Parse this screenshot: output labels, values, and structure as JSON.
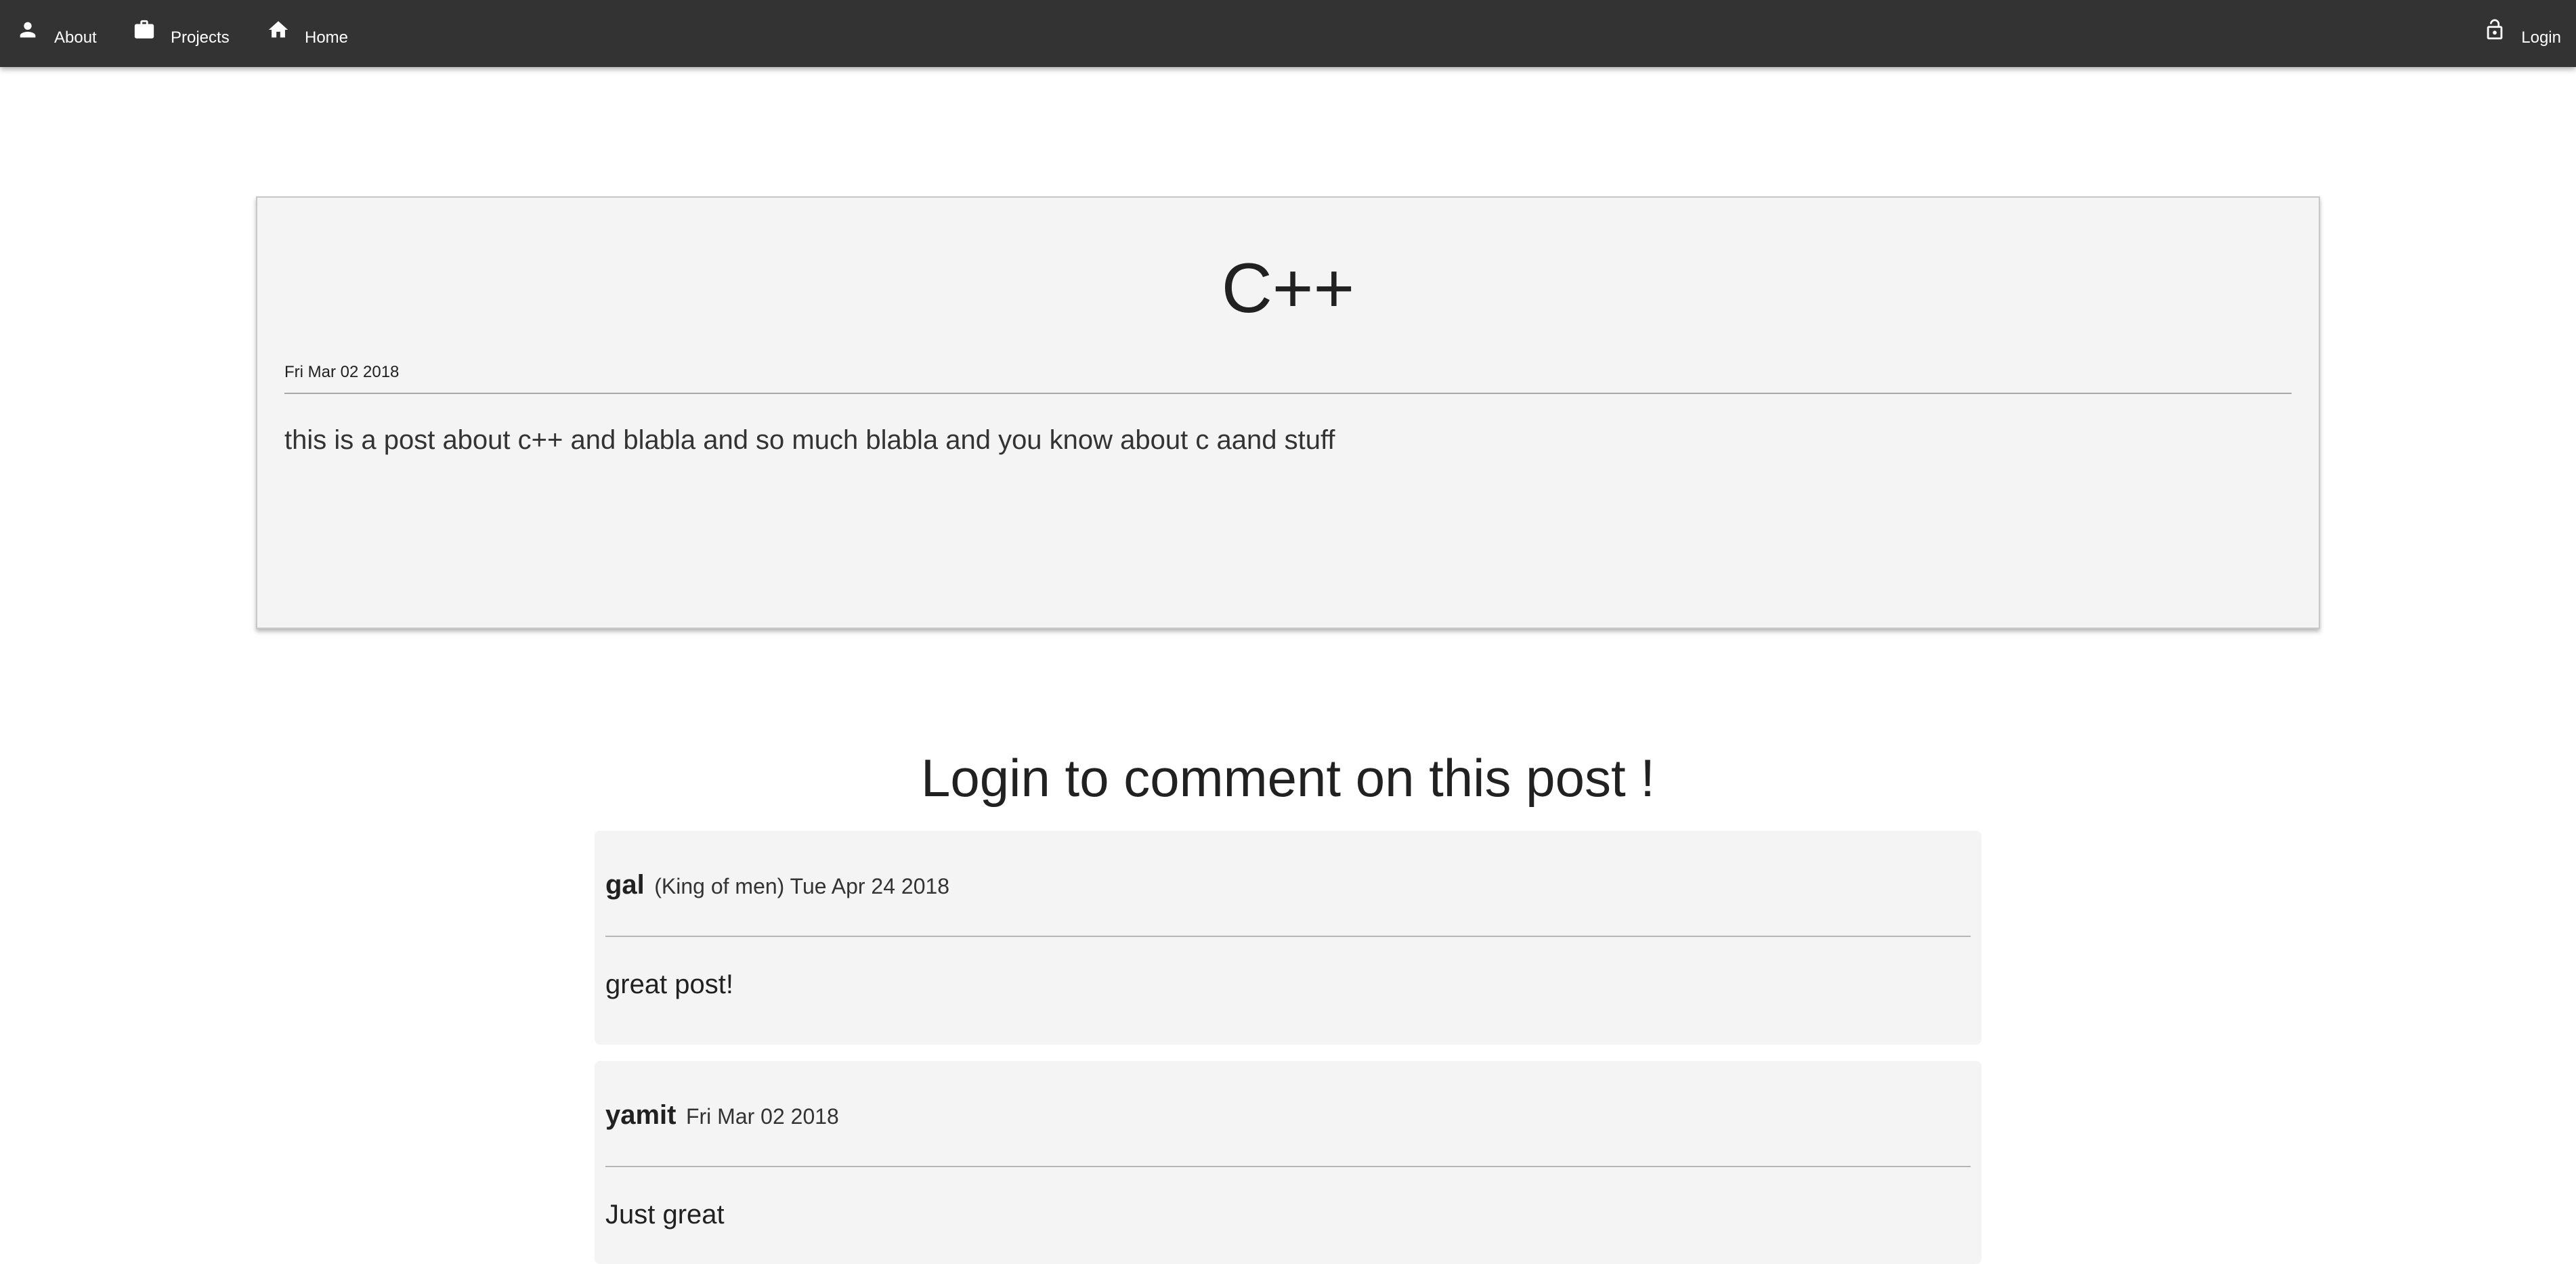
{
  "nav": {
    "left_items": [
      {
        "label": "About",
        "icon": "person-icon"
      },
      {
        "label": "Projects",
        "icon": "briefcase-icon"
      },
      {
        "label": "Home",
        "icon": "home-icon"
      }
    ],
    "right_item": {
      "label": "Login",
      "icon": "lock-open-icon"
    },
    "background_color": "#333333"
  },
  "post": {
    "title": "C++",
    "date": "Fri Mar 02 2018",
    "body": "this is a post about c++ and blabla and so much blabla and you know about c aand stuff"
  },
  "comments_section": {
    "heading": "Login to comment on this post !",
    "comments": [
      {
        "author": "gal",
        "meta": "(King of men) Tue Apr 24 2018",
        "text": "great post!"
      },
      {
        "author": "yamit",
        "meta": "Fri Mar 02 2018",
        "text": "Just great"
      }
    ]
  }
}
